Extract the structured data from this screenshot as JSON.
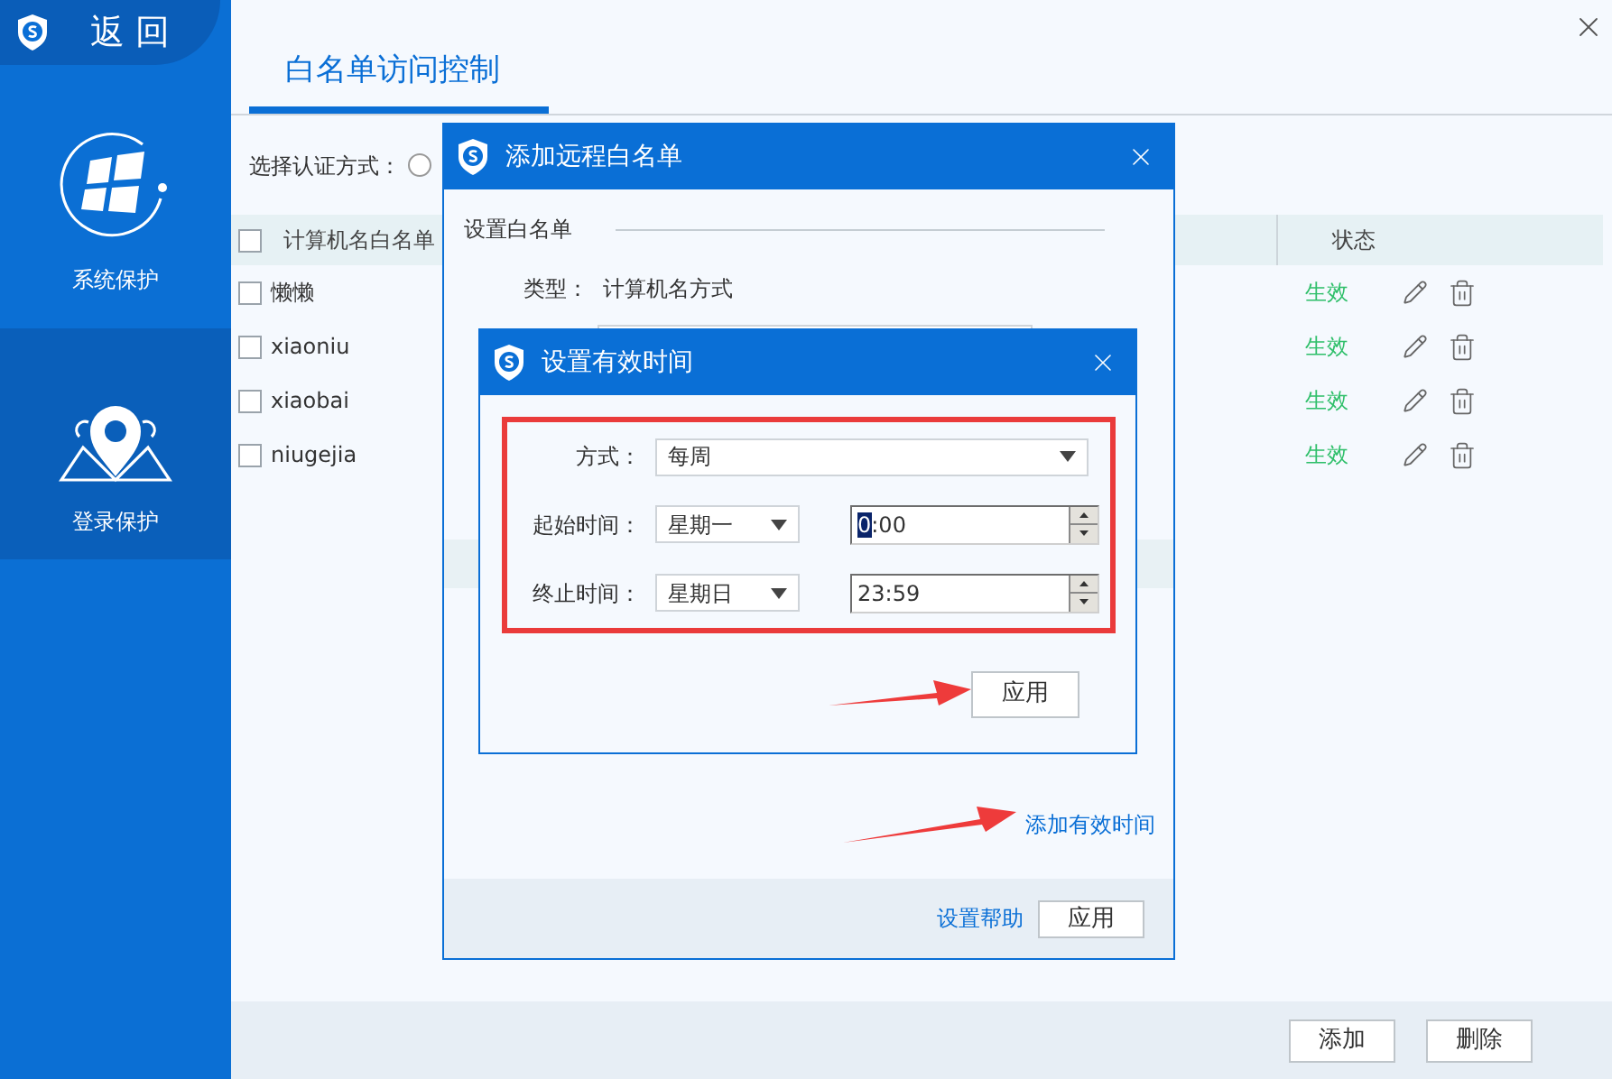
{
  "back": {
    "label": "返 回"
  },
  "sidebar": {
    "items": [
      {
        "label": "系统保护",
        "selected": false,
        "kind": "windows"
      },
      {
        "label": "登录保护",
        "selected": true,
        "kind": "location"
      }
    ]
  },
  "page": {
    "tab": "白名单访问控制",
    "auth_label": "选择认证方式：",
    "auth_radio_selected": false,
    "table": {
      "header_checked": false,
      "columns": [
        "计算机名白名单",
        "状态"
      ],
      "rows": [
        {
          "name": "懒懒",
          "status": "生效",
          "checked": false
        },
        {
          "name": "xiaoniu",
          "status": "生效",
          "checked": false
        },
        {
          "name": "xiaobai",
          "status": "生效",
          "checked": false
        },
        {
          "name": "niugejia",
          "status": "生效",
          "checked": false
        }
      ]
    },
    "buttons": [
      "添加",
      "删除"
    ]
  },
  "dialog": {
    "title": "添加远程白名单",
    "section": "设置白名单",
    "type_label": "类型：",
    "type_value": "计算机名方式",
    "link": "添加有效时间",
    "help": "设置帮助",
    "apply": "应用"
  },
  "time_dialog": {
    "title": "设置有效时间",
    "fields": [
      {
        "kind": "select",
        "label": "方式：",
        "value": "每周"
      },
      {
        "kind": "range",
        "label": "起始时间：",
        "day": "星期一",
        "time": "0:00",
        "focused": true
      },
      {
        "kind": "range",
        "label": "终止时间：",
        "day": "星期日",
        "time": "23:59",
        "focused": false
      }
    ],
    "apply": "应用"
  }
}
